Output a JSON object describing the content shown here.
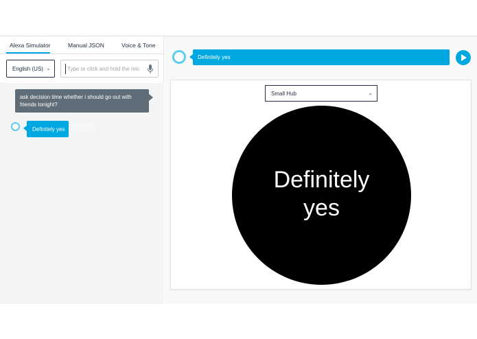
{
  "tabs": [
    {
      "label": "Alexa Simulator",
      "active": true
    },
    {
      "label": "Manual JSON",
      "active": false
    },
    {
      "label": "Voice & Tone",
      "active": false
    }
  ],
  "locale": {
    "selected": "English (US)",
    "chevron_icon": "chevron-down-icon"
  },
  "utterance": {
    "placeholder": "Type or click and hold the mic",
    "value": "",
    "mic_icon": "microphone-icon"
  },
  "chat": {
    "user_message": "ask decision time whether i should go out with friends tonight?",
    "alexa_message": "Definitely yes"
  },
  "response": {
    "text": "Definitely yes",
    "play_icon": "play-icon"
  },
  "device": {
    "selected": "Small Hub",
    "display_text_line1": "Definitely",
    "display_text_line2": "yes"
  },
  "colors": {
    "accent": "#00a8e1",
    "user_bubble": "#5f6d78",
    "ring": "#5fcbf0",
    "hub_bg": "#000000"
  }
}
